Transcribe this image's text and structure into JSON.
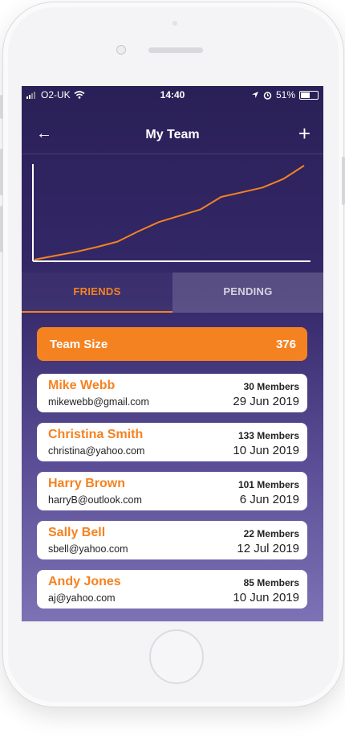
{
  "status": {
    "carrier": "O2-UK",
    "time": "14:40",
    "battery": "51%"
  },
  "header": {
    "title": "My Team"
  },
  "chart_data": {
    "type": "line",
    "x": [
      1,
      2,
      3,
      4,
      5,
      6,
      7,
      8,
      9,
      10,
      11,
      12,
      13,
      14
    ],
    "values": [
      0,
      5,
      10,
      16,
      23,
      36,
      48,
      56,
      64,
      80,
      86,
      92,
      103,
      120
    ],
    "color": "#f58221"
  },
  "tabs": [
    {
      "label": "FRIENDS",
      "active": true
    },
    {
      "label": "PENDING",
      "active": false
    }
  ],
  "team_size": {
    "label": "Team Size",
    "value": "376"
  },
  "members": [
    {
      "name": "Mike Webb",
      "email": "mikewebb@gmail.com",
      "members": "30 Members",
      "date": "29 Jun 2019"
    },
    {
      "name": "Christina Smith",
      "email": "christina@yahoo.com",
      "members": "133 Members",
      "date": "10 Jun 2019"
    },
    {
      "name": "Harry Brown",
      "email": "harryB@outlook.com",
      "members": "101 Members",
      "date": "6 Jun 2019"
    },
    {
      "name": "Sally Bell",
      "email": "sbell@yahoo.com",
      "members": "22 Members",
      "date": "12 Jul 2019"
    },
    {
      "name": "Andy Jones",
      "email": "aj@yahoo.com",
      "members": "85 Members",
      "date": "10 Jun 2019"
    }
  ],
  "colors": {
    "accent": "#f58221",
    "background": "#2a2057"
  }
}
